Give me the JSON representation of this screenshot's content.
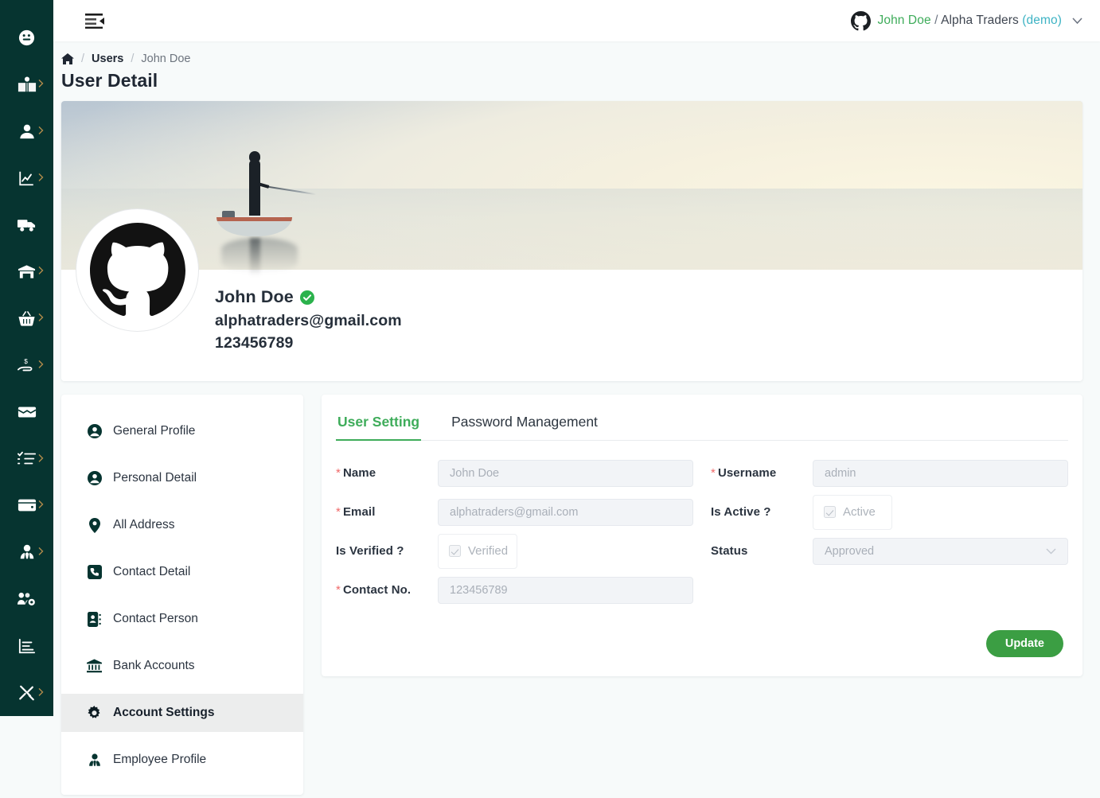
{
  "colors": {
    "sidebar_bg": "#063430",
    "accent_green": "#3eac5a",
    "button_green": "#3b9e43",
    "demo_teal": "#3db3c4",
    "required_red": "#f06a6a",
    "page_bg": "#f7fafa"
  },
  "sidebar": {
    "items": [
      {
        "icon": "dashboard-icon",
        "has_caret": false
      },
      {
        "icon": "book-reader-icon",
        "has_caret": true
      },
      {
        "icon": "user-icon",
        "has_caret": true
      },
      {
        "icon": "chart-line-icon",
        "has_caret": true
      },
      {
        "icon": "truck-icon",
        "has_caret": false
      },
      {
        "icon": "warehouse-icon",
        "has_caret": true
      },
      {
        "icon": "shopping-basket-icon",
        "has_caret": true
      },
      {
        "icon": "hand-holding-usd-icon",
        "has_caret": true
      },
      {
        "icon": "money-check-icon",
        "has_caret": false
      },
      {
        "icon": "tasks-list-icon",
        "has_caret": true
      },
      {
        "icon": "wallet-icon",
        "has_caret": true
      },
      {
        "icon": "user-tie-icon",
        "has_caret": true
      },
      {
        "icon": "users-cog-icon",
        "has_caret": false
      },
      {
        "icon": "chart-bar-icon",
        "has_caret": false
      },
      {
        "icon": "tools-icon",
        "has_caret": true
      }
    ]
  },
  "topbar": {
    "menu_toggle_icon": "menu-fold-icon",
    "avatar_icon": "github-icon",
    "user_name": "John Doe",
    "separator": "/",
    "organization": "Alpha Traders",
    "environment": "(demo)",
    "caret_icon": "chevron-down-icon"
  },
  "breadcrumb": {
    "home_icon": "home-icon",
    "slash": "/",
    "items": [
      {
        "label": "Users",
        "current": false
      },
      {
        "label": "John Doe",
        "current": true
      }
    ]
  },
  "page": {
    "title": "User Detail"
  },
  "profile": {
    "banner_alt": "lake-fisherman-banner",
    "avatar_icon": "github-icon",
    "name": "John Doe",
    "verified_icon": "verified-check-icon",
    "email": "alphatraders@gmail.com",
    "phone": "123456789"
  },
  "menu": {
    "items": [
      {
        "label": "General Profile",
        "icon": "user-circle-icon",
        "active": false
      },
      {
        "label": "Personal Detail",
        "icon": "user-circle-icon",
        "active": false
      },
      {
        "label": "All Address",
        "icon": "map-marker-icon",
        "active": false
      },
      {
        "label": "Contact Detail",
        "icon": "phone-square-icon",
        "active": false
      },
      {
        "label": "Contact Person",
        "icon": "address-book-icon",
        "active": false
      },
      {
        "label": "Bank Accounts",
        "icon": "bank-icon",
        "active": false
      },
      {
        "label": "Account Settings",
        "icon": "gear-icon",
        "active": true
      },
      {
        "label": "Employee Profile",
        "icon": "user-tie-icon",
        "active": false
      }
    ]
  },
  "form": {
    "tabs": [
      {
        "label": "User Setting",
        "active": true
      },
      {
        "label": "Password Management",
        "active": false
      }
    ],
    "fields": {
      "name": {
        "label": "Name",
        "required": true,
        "value": "John Doe"
      },
      "username": {
        "label": "Username",
        "required": true,
        "value": "admin"
      },
      "email": {
        "label": "Email",
        "required": true,
        "value": "alphatraders@gmail.com"
      },
      "is_active": {
        "label": "Is Active ?",
        "required": false,
        "checkbox_label": "Active",
        "checked": true
      },
      "is_verified": {
        "label": "Is Verified ?",
        "required": false,
        "checkbox_label": "Verified",
        "checked": true
      },
      "status": {
        "label": "Status",
        "required": false,
        "value": "Approved",
        "caret_icon": "chevron-down-icon"
      },
      "contact_no": {
        "label": "Contact No.",
        "required": true,
        "value": "123456789"
      }
    },
    "submit_label": "Update"
  }
}
